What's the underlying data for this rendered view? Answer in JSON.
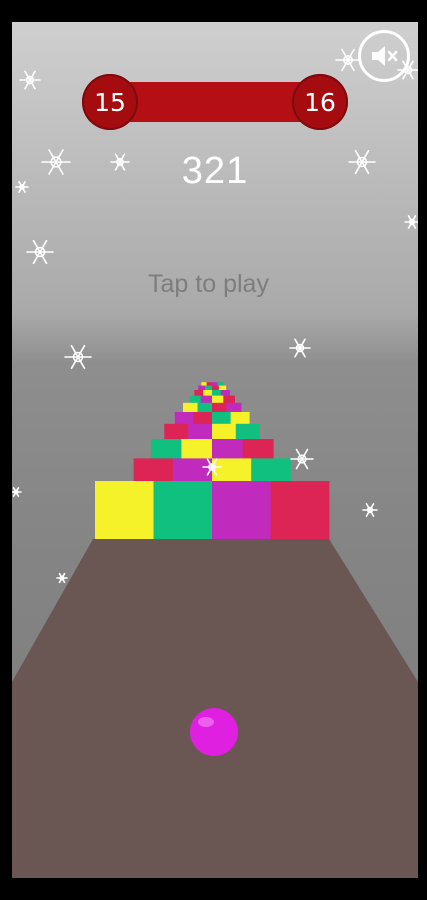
{
  "hud": {
    "level_current": "15",
    "level_next": "16",
    "score": "321",
    "tap_to_play": "Tap to play"
  },
  "icons": {
    "mute": "speaker-muted-icon",
    "snowflake": "snowflake-icon"
  },
  "colors": {
    "level_bar": "#b30f14",
    "level_badge": "#a50c10",
    "ball": "#e020e0",
    "track": "#6a5753",
    "block_yellow": "#f5f22a",
    "block_green": "#10c07e",
    "block_magenta": "#c02bbd",
    "block_red": "#dc2555"
  },
  "track": {
    "block_rows": [
      [
        "yellow",
        "green",
        "magenta",
        "red"
      ],
      [
        "red",
        "magenta",
        "yellow",
        "green"
      ],
      [
        "green",
        "yellow",
        "magenta",
        "red"
      ],
      [
        "red",
        "magenta",
        "yellow",
        "green"
      ],
      [
        "magenta",
        "red",
        "green",
        "yellow"
      ],
      [
        "yellow",
        "green",
        "red",
        "magenta"
      ],
      [
        "green",
        "magenta",
        "yellow",
        "red"
      ],
      [
        "red",
        "yellow",
        "green",
        "magenta"
      ],
      [
        "magenta",
        "green",
        "red",
        "yellow"
      ],
      [
        "yellow",
        "red",
        "magenta",
        "green"
      ]
    ]
  }
}
